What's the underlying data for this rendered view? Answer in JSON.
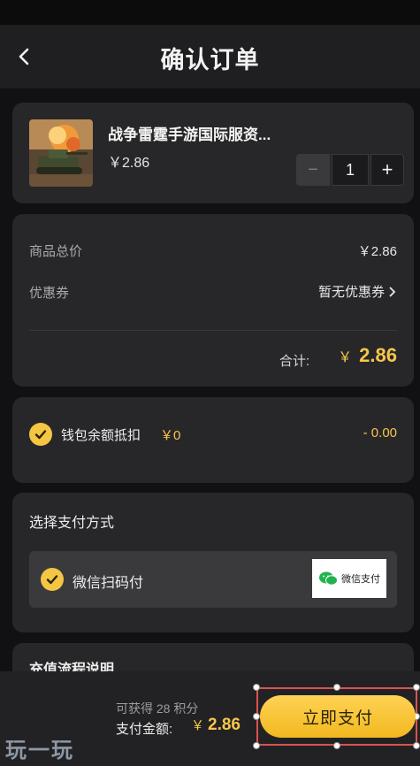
{
  "header": {
    "title": "确认订单"
  },
  "product": {
    "name": "战争雷霆手游国际服资...",
    "price": "￥2.86",
    "quantity": "1",
    "minus_label": "−",
    "plus_label": "+"
  },
  "summary": {
    "subtotal_label": "商品总价",
    "subtotal_value": "￥2.86",
    "coupon_label": "优惠券",
    "coupon_value": "暂无优惠券",
    "total_label": "合计:",
    "total_currency": "￥",
    "total_value": "2.86"
  },
  "wallet": {
    "label": "钱包余额抵扣",
    "balance": "￥0",
    "deduction": "- 0.00"
  },
  "payment": {
    "section_title": "选择支付方式",
    "option_label": "微信扫码付",
    "badge_text": "微信支付"
  },
  "recharge": {
    "title": "充值流程说明"
  },
  "bottom": {
    "points_text": "可获得 28 积分",
    "amount_label": "支付金额:",
    "amount_currency": "￥",
    "amount_value": "2.86",
    "pay_button": "立即支付"
  },
  "watermark": "玩一玩",
  "colors": {
    "accent": "#f7c64a",
    "background": "#111113",
    "card": "#272729"
  }
}
